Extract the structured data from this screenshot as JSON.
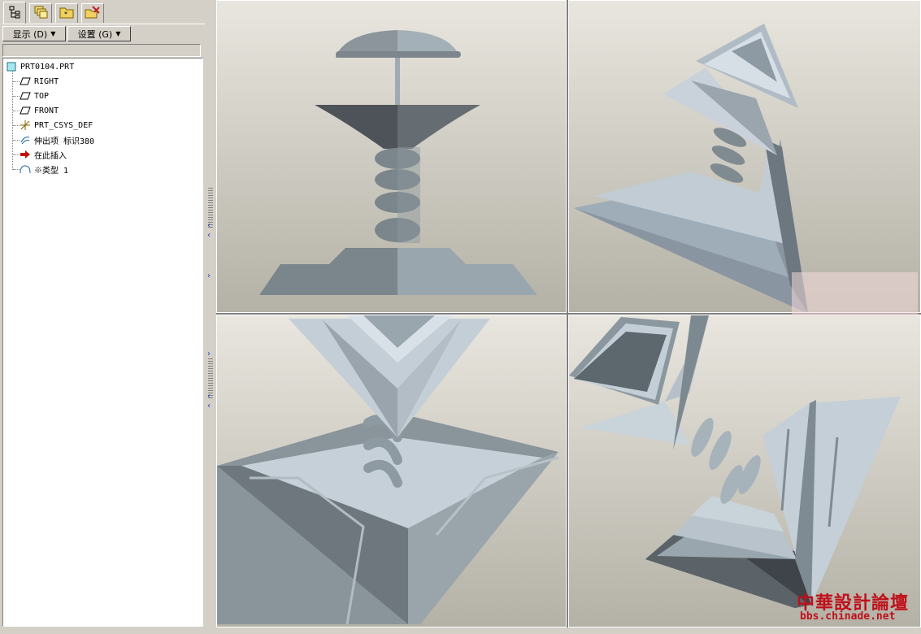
{
  "tabs": [
    {
      "icon": "model-tree-icon"
    },
    {
      "icon": "layers-icon"
    },
    {
      "icon": "folder-browser-icon"
    },
    {
      "icon": "favorites-icon"
    }
  ],
  "toolbar": {
    "show_label": "显示 (D)",
    "settings_label": "设置 (G)"
  },
  "tree": {
    "root": "PRT0104.PRT",
    "items": [
      {
        "label": "RIGHT",
        "icon": "datum-plane-icon"
      },
      {
        "label": "TOP",
        "icon": "datum-plane-icon"
      },
      {
        "label": "FRONT",
        "icon": "datum-plane-icon"
      },
      {
        "label": "PRT_CSYS_DEF",
        "icon": "coordinate-system-icon"
      },
      {
        "label": "伸出项 标识380",
        "icon": "protrusion-icon"
      },
      {
        "label": "在此插入",
        "icon": "insert-here-arrow-icon"
      },
      {
        "label": "※类型 1",
        "icon": "feature-type-icon"
      }
    ]
  },
  "watermark": {
    "title": "中華設計論壇",
    "url": "bbs.chinade.net"
  },
  "colors": {
    "accent_red": "#c0101a",
    "viewport_top": "#e9e6df",
    "viewport_bottom": "#b4b1a6"
  }
}
